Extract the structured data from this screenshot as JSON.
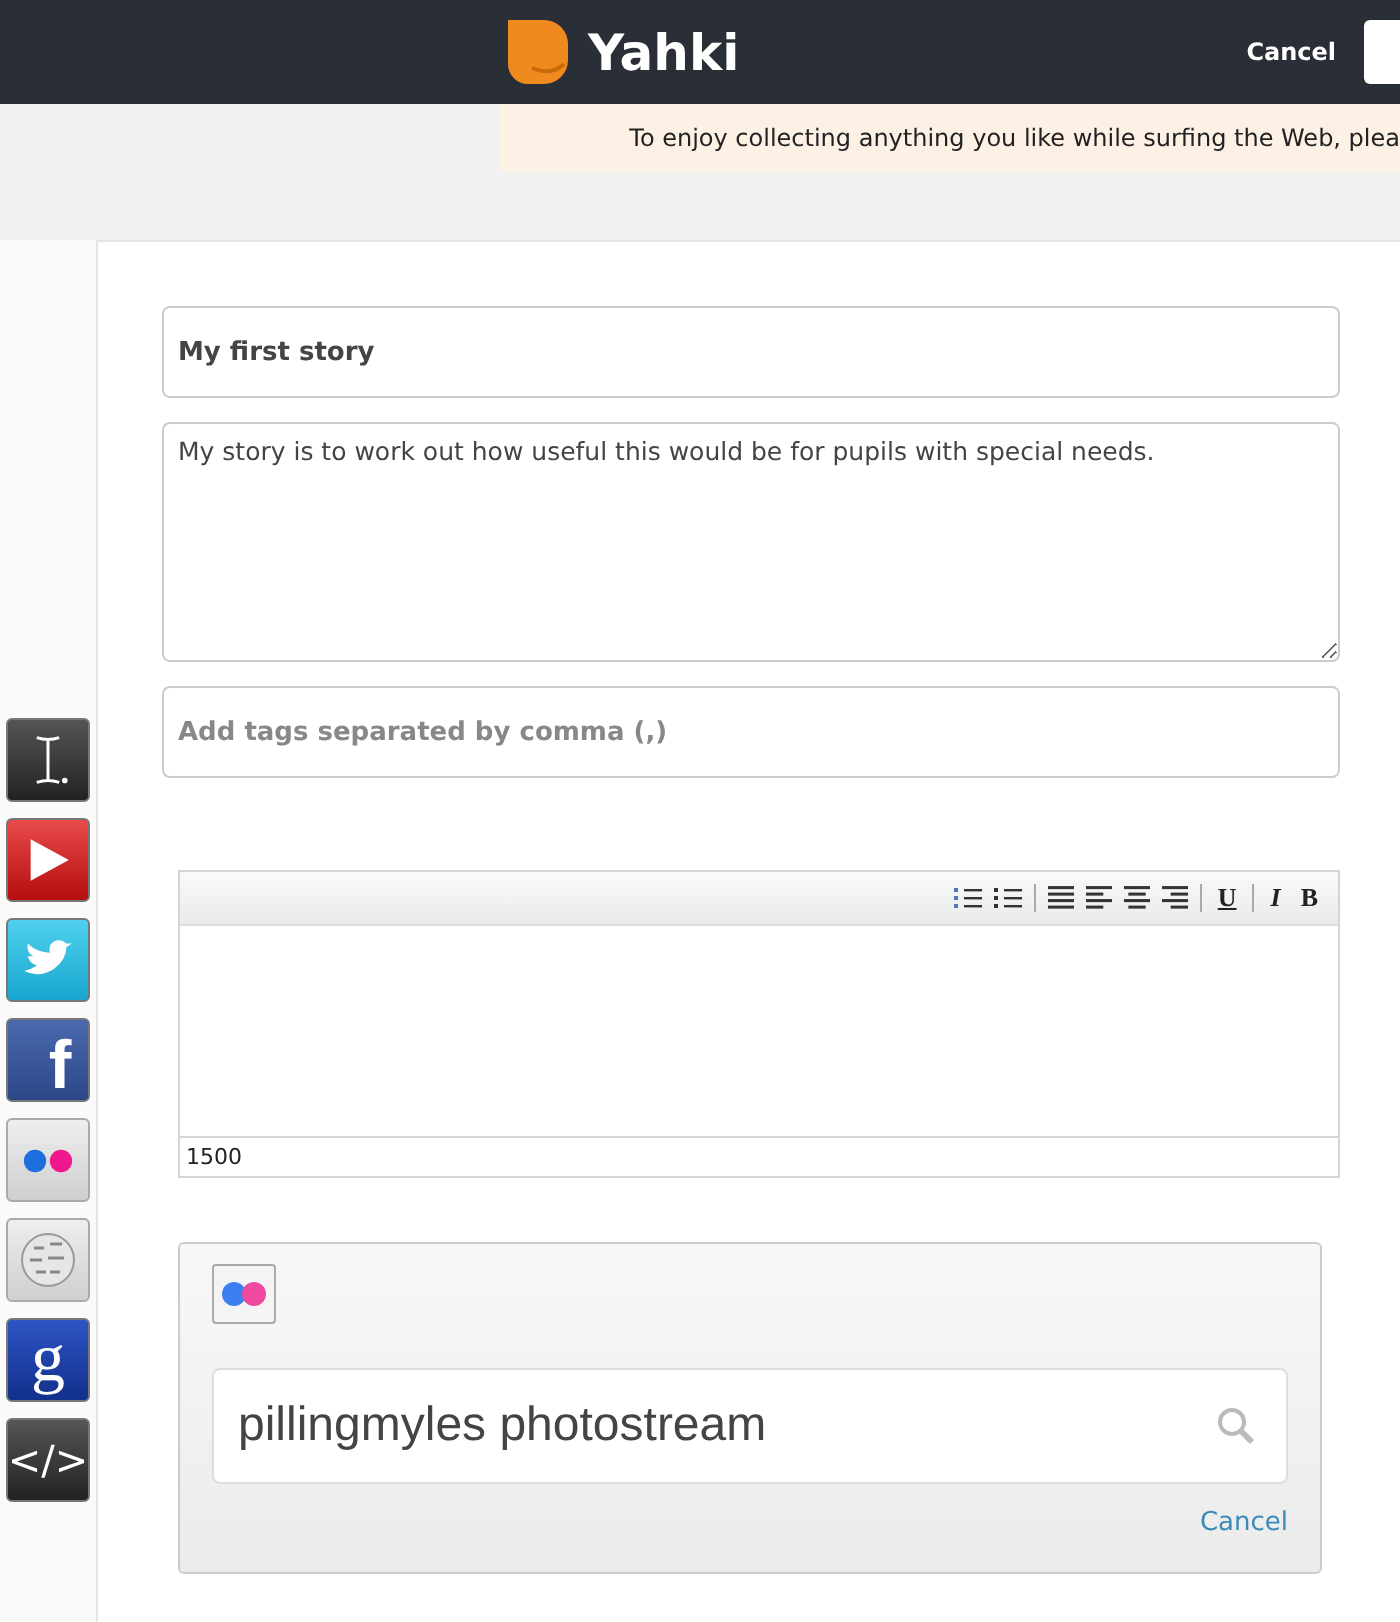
{
  "header": {
    "logo_text": "Yahki",
    "cancel": "Cancel"
  },
  "banner": {
    "text": "To enjoy collecting anything you like while surfing the Web, plea"
  },
  "story": {
    "title": "My first story",
    "description": "My story is to work out how useful this would be for pupils with special needs.",
    "tags_placeholder": "Add tags separated by comma (,)"
  },
  "sidebar": {
    "items": [
      {
        "kind": "text"
      },
      {
        "kind": "youtube"
      },
      {
        "kind": "twitter"
      },
      {
        "kind": "facebook",
        "glyph": "f"
      },
      {
        "kind": "flickr"
      },
      {
        "kind": "wikipedia"
      },
      {
        "kind": "google",
        "glyph": "g"
      },
      {
        "kind": "embed",
        "glyph": "</>"
      }
    ]
  },
  "editor": {
    "toolbar": [
      {
        "kind": "ordered-list"
      },
      {
        "kind": "bullet-list"
      },
      {
        "kind": "separator"
      },
      {
        "kind": "justify"
      },
      {
        "kind": "align-left"
      },
      {
        "kind": "align-center"
      },
      {
        "kind": "align-right"
      },
      {
        "kind": "separator"
      },
      {
        "kind": "underline",
        "label": "U"
      },
      {
        "kind": "separator"
      },
      {
        "kind": "italic",
        "label": "I"
      },
      {
        "kind": "bold",
        "label": "B"
      }
    ],
    "counter": "1500"
  },
  "flickr_panel": {
    "search_value": "pillingmyles photostream",
    "cancel": "Cancel"
  }
}
